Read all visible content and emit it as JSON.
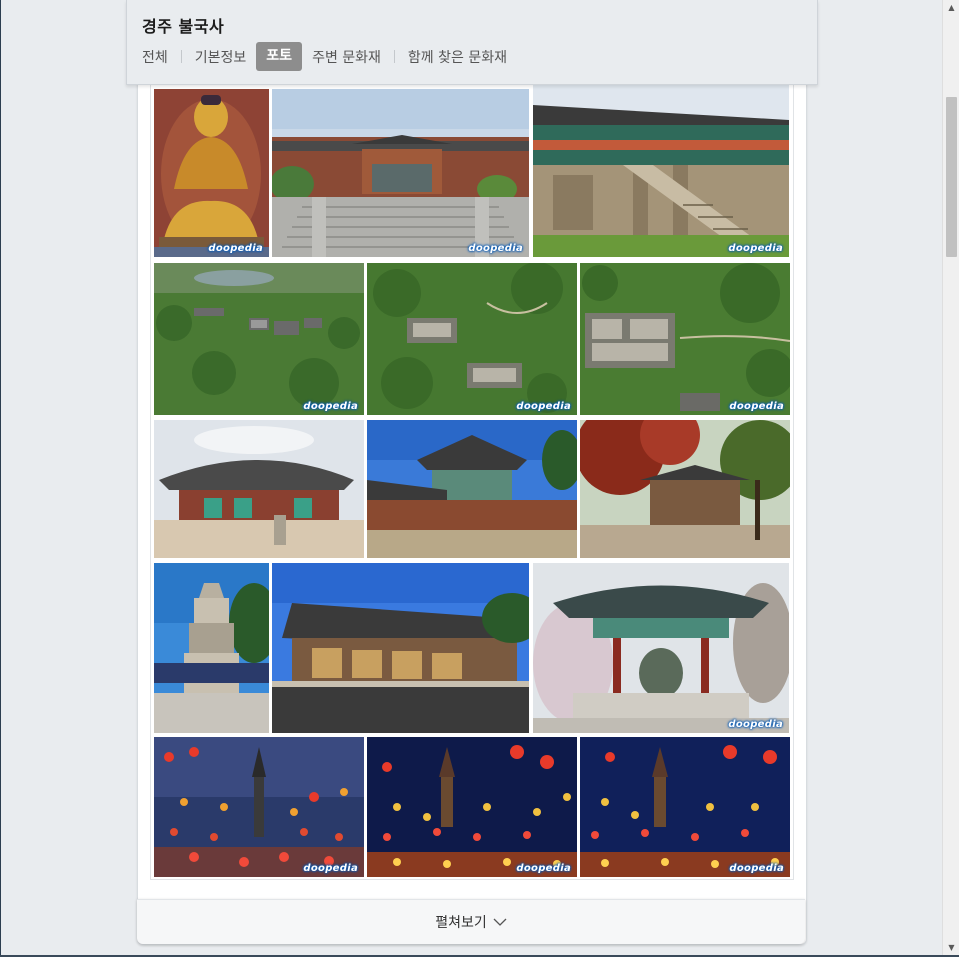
{
  "header": {
    "title": "경주 불국사",
    "tabs": [
      {
        "label": "전체"
      },
      {
        "label": "기본정보"
      },
      {
        "label": "포토",
        "active": true
      },
      {
        "label": "주변 문화재"
      },
      {
        "label": "함께 찾은 문화재"
      }
    ]
  },
  "gallery": {
    "watermark": "doopedia",
    "photos": [
      {
        "name": "golden-buddha-statue",
        "watermark": true
      },
      {
        "name": "temple-entrance-stairs",
        "watermark": true
      },
      {
        "name": "stone-stairway-bridges",
        "watermark": true
      },
      {
        "name": "aerial-view-1",
        "watermark": true
      },
      {
        "name": "aerial-view-2",
        "watermark": true
      },
      {
        "name": "aerial-view-3",
        "watermark": true
      },
      {
        "name": "daeungjeon-hall",
        "watermark": false
      },
      {
        "name": "pavilion-blue-sky",
        "watermark": false
      },
      {
        "name": "autumn-maple-courtyard",
        "watermark": false
      },
      {
        "name": "dabotap-pagoda",
        "watermark": false
      },
      {
        "name": "long-hall-building",
        "watermark": false
      },
      {
        "name": "bell-pavilion",
        "watermark": true
      },
      {
        "name": "lantern-festival-1",
        "watermark": true
      },
      {
        "name": "lantern-festival-2",
        "watermark": true
      },
      {
        "name": "lantern-festival-3",
        "watermark": true
      }
    ]
  },
  "expand_button": {
    "label": "펼쳐보기",
    "icon": "chevron-down-icon"
  },
  "colors": {
    "page_bg": "#e9ecef",
    "active_tab_bg": "#8d8d8d",
    "watermark_glow": "#0a5db8"
  }
}
